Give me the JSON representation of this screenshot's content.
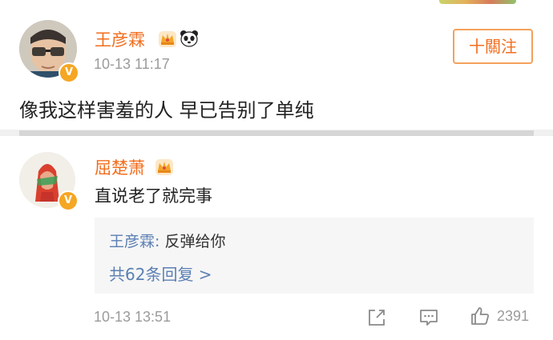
{
  "post": {
    "author": "王彦霖",
    "time": "10-13 11:17",
    "follow_label": "十關注",
    "content": "像我这样害羞的人 早已告别了单纯",
    "verified_badge": "V",
    "author_icons": [
      "crown-icon",
      "panda-icon"
    ]
  },
  "reply": {
    "author": "屈楚萧",
    "text": "直说老了就完事",
    "verified_badge": "V",
    "author_icons": [
      "crown-icon"
    ],
    "quote": {
      "author": "王彦霖:",
      "message": " 反弹给你",
      "more": "共62条回复 >"
    },
    "time": "10-13 13:51",
    "like_count": "2391",
    "actions": [
      "share-icon",
      "comment-icon",
      "like-icon"
    ]
  },
  "colors": {
    "name": "#f26d1d",
    "link": "#5b7fb3",
    "muted": "#9b9b9b",
    "follow_border": "#f3a15d",
    "quote_bg": "#f6f6f6"
  }
}
